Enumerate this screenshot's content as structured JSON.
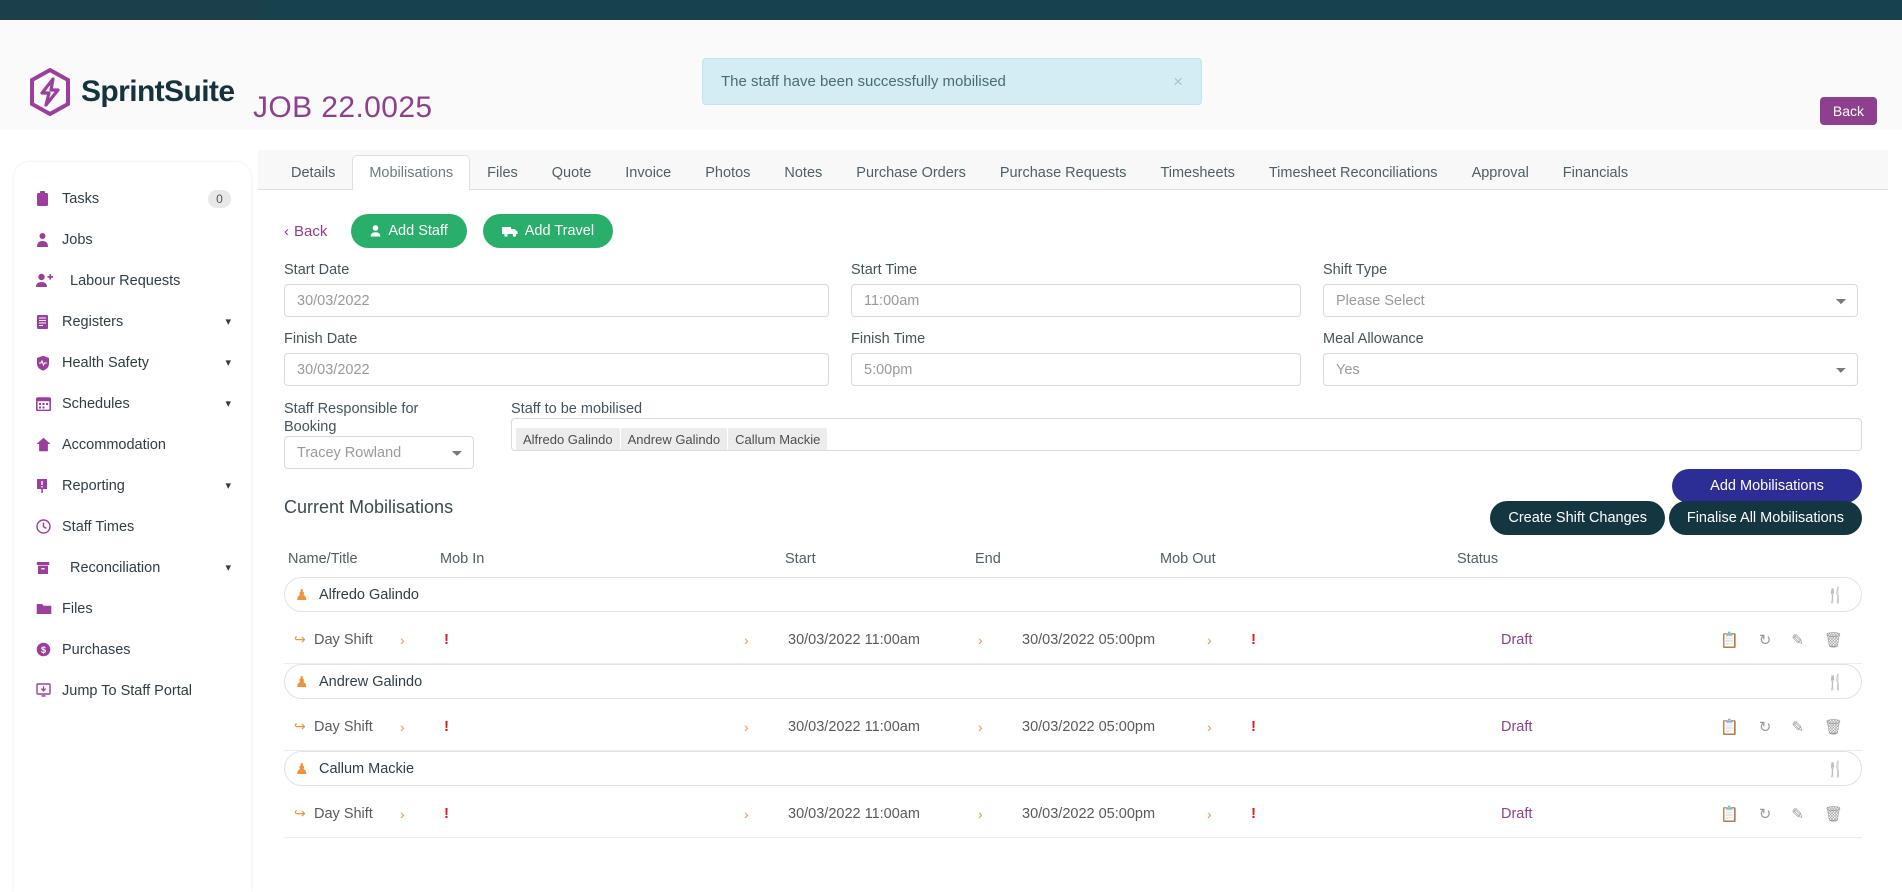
{
  "brand": {
    "name": "SprintSuite",
    "logo_icon": "sprintsuite-bolt-hexagon-logo",
    "accent": "#8e3f8e",
    "dark": "#16333d"
  },
  "header": {
    "job_title": "JOB 22.0025",
    "back_button": "Back",
    "alert": {
      "message": "The staff have been successfully mobilised",
      "close_icon": "close-icon"
    }
  },
  "sidebar": {
    "items": [
      {
        "label": "Tasks",
        "icon": "clipboard-icon",
        "badge": "0"
      },
      {
        "label": "Jobs",
        "icon": "briefcase-person-icon"
      },
      {
        "label": "Labour Requests",
        "icon": "user-plus-icon",
        "indent": true
      },
      {
        "label": "Registers",
        "icon": "book-icon",
        "chevron": "chevron-down-icon"
      },
      {
        "label": "Health Safety",
        "icon": "shield-heartbeat-icon",
        "chevron": "chevron-down-icon"
      },
      {
        "label": "Schedules",
        "icon": "calendar-icon",
        "chevron": "chevron-down-icon"
      },
      {
        "label": "Accommodation",
        "icon": "home-icon"
      },
      {
        "label": "Reporting",
        "icon": "report-flag-icon",
        "chevron": "chevron-down-icon"
      },
      {
        "label": "Staff Times",
        "icon": "clock-icon"
      },
      {
        "label": "Reconciliation",
        "icon": "archive-box-icon",
        "chevron": "chevron-down-icon",
        "indent": true
      },
      {
        "label": "Files",
        "icon": "folder-icon"
      },
      {
        "label": "Purchases",
        "icon": "dollar-circle-icon"
      },
      {
        "label": "Jump To Staff Portal",
        "icon": "external-monitor-icon"
      }
    ]
  },
  "tabs": {
    "active": "Mobilisations",
    "items": [
      "Details",
      "Mobilisations",
      "Files",
      "Quote",
      "Invoice",
      "Photos",
      "Notes",
      "Purchase Orders",
      "Purchase Requests",
      "Timesheets",
      "Timesheet Reconciliations",
      "Approval",
      "Financials"
    ]
  },
  "toolbar": {
    "back_label": "Back",
    "back_icon": "chevron-left-icon",
    "add_staff_label": "Add Staff",
    "add_staff_icon": "person-icon",
    "add_travel_label": "Add Travel",
    "add_travel_icon": "truck-icon"
  },
  "form": {
    "start_date": {
      "label": "Start Date",
      "value": "30/03/2022"
    },
    "start_time": {
      "label": "Start Time",
      "value": "11:00am"
    },
    "shift_type": {
      "label": "Shift Type",
      "value": "Please Select"
    },
    "finish_date": {
      "label": "Finish Date",
      "value": "30/03/2022"
    },
    "finish_time": {
      "label": "Finish Time",
      "value": "5:00pm"
    },
    "meal_allowance": {
      "label": "Meal Allowance",
      "value": "Yes"
    },
    "staff_responsible": {
      "label": "Staff Responsible for Booking",
      "value": "Tracey Rowland"
    },
    "staff_to_mobilise": {
      "label": "Staff to be mobilised",
      "chips": [
        "Alfredo Galindo",
        "Andrew Galindo",
        "Callum Mackie"
      ]
    }
  },
  "section": {
    "title": "Current Mobilisations",
    "add_mobilisations": "Add Mobilisations",
    "create_shift_changes": "Create Shift Changes",
    "finalise_all": "Finalise All Mobilisations"
  },
  "table": {
    "columns": [
      "Name/Title",
      "Mob In",
      "Start",
      "End",
      "Mob Out",
      "Status"
    ],
    "groups": [
      {
        "staff_name": "Alfredo Galindo",
        "staff_icon": "person-icon",
        "meal_icon": "cutlery-icon",
        "shifts": [
          {
            "name": "Day Shift",
            "mob_in": "!",
            "start": "30/03/2022 11:00am",
            "end": "30/03/2022 05:00pm",
            "mob_out": "!",
            "status": "Draft",
            "actions": [
              "copy-icon",
              "refresh-icon",
              "edit-pencil-icon",
              "delete-trash-icon"
            ]
          }
        ]
      },
      {
        "staff_name": "Andrew Galindo",
        "staff_icon": "person-icon",
        "meal_icon": "cutlery-icon",
        "shifts": [
          {
            "name": "Day Shift",
            "mob_in": "!",
            "start": "30/03/2022 11:00am",
            "end": "30/03/2022 05:00pm",
            "mob_out": "!",
            "status": "Draft",
            "actions": [
              "copy-icon",
              "refresh-icon",
              "edit-pencil-icon",
              "delete-trash-icon"
            ]
          }
        ]
      },
      {
        "staff_name": "Callum Mackie",
        "staff_icon": "person-icon",
        "meal_icon": "cutlery-icon",
        "shifts": [
          {
            "name": "Day Shift",
            "mob_in": "!",
            "start": "30/03/2022 11:00am",
            "end": "30/03/2022 05:00pm",
            "mob_out": "!",
            "status": "Draft",
            "actions": [
              "copy-icon",
              "refresh-icon",
              "edit-pencil-icon",
              "delete-trash-icon"
            ]
          }
        ]
      }
    ]
  }
}
